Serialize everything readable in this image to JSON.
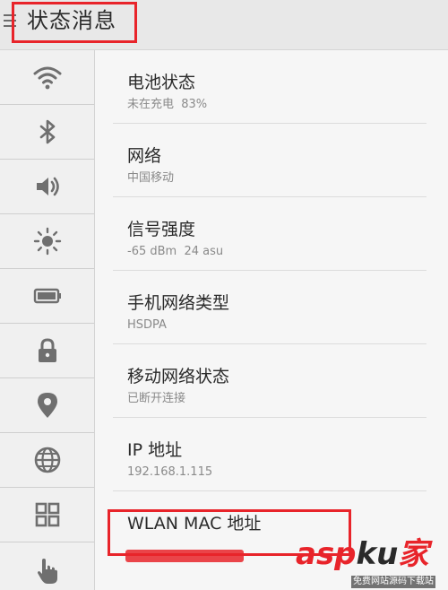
{
  "header": {
    "title": "状态消息"
  },
  "sidebar": {
    "items": [
      {
        "icon": "wifi-icon"
      },
      {
        "icon": "bluetooth-icon"
      },
      {
        "icon": "volume-icon"
      },
      {
        "icon": "brightness-icon"
      },
      {
        "icon": "battery-icon"
      },
      {
        "icon": "lock-icon"
      },
      {
        "icon": "location-icon"
      },
      {
        "icon": "globe-icon"
      },
      {
        "icon": "apps-grid-icon"
      },
      {
        "icon": "touch-icon"
      }
    ]
  },
  "status": {
    "rows": [
      {
        "title": "电池状态",
        "value": "未在充电  83%"
      },
      {
        "title": "网络",
        "value": "中国移动"
      },
      {
        "title": "信号强度",
        "value": "-65 dBm  24 asu"
      },
      {
        "title": "手机网络类型",
        "value": "HSDPA"
      },
      {
        "title": "移动网络状态",
        "value": "已断开连接"
      },
      {
        "title": "IP 地址",
        "value": "192.168.1.115"
      },
      {
        "title": "WLAN MAC 地址",
        "value": ""
      }
    ]
  },
  "watermark": {
    "brand_a": "asp",
    "brand_b": "ku",
    "brand_c": "家",
    "tagline": "免费网站源码下载站"
  },
  "colors": {
    "highlight": "#e8242a",
    "icon_gray": "#6f6f6f"
  }
}
